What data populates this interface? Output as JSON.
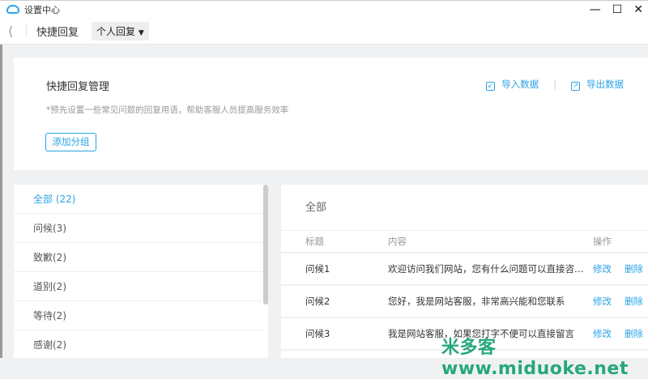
{
  "window": {
    "title": "设置中心"
  },
  "header": {
    "title": "快捷回复",
    "selector": "个人回复"
  },
  "card": {
    "title": "快捷回复管理",
    "description": "*预先设置一些常见问题的回复用语，帮助客服人员提高服务效率",
    "add_group": "添加分组",
    "import": "导入数据",
    "export": "导出数据"
  },
  "groups": [
    {
      "label": "全部 (22)",
      "active": true
    },
    {
      "label": "问候(3)"
    },
    {
      "label": "致歉(2)"
    },
    {
      "label": "道别(2)"
    },
    {
      "label": "等待(2)"
    },
    {
      "label": "感谢(2)"
    }
  ],
  "table": {
    "title": "全部",
    "columns": [
      "标题",
      "内容",
      "操作"
    ],
    "rows": [
      {
        "title": "问候1",
        "content": "欢迎访问我们网站，您有什么问题可以直接咨询我们",
        "edit": "修改",
        "delete": "删除"
      },
      {
        "title": "问候2",
        "content": "您好，我是网站客服，非常高兴能和您联系",
        "edit": "修改",
        "delete": "删除"
      },
      {
        "title": "问候3",
        "content": "我是网站客服，如果您打字不便可以直接留言",
        "edit": "修改",
        "delete": "删除"
      }
    ]
  },
  "watermark": "米多客www.miduoke.net",
  "colors": {
    "accent": "#2aa3e6",
    "background": "#f0f1f3"
  }
}
